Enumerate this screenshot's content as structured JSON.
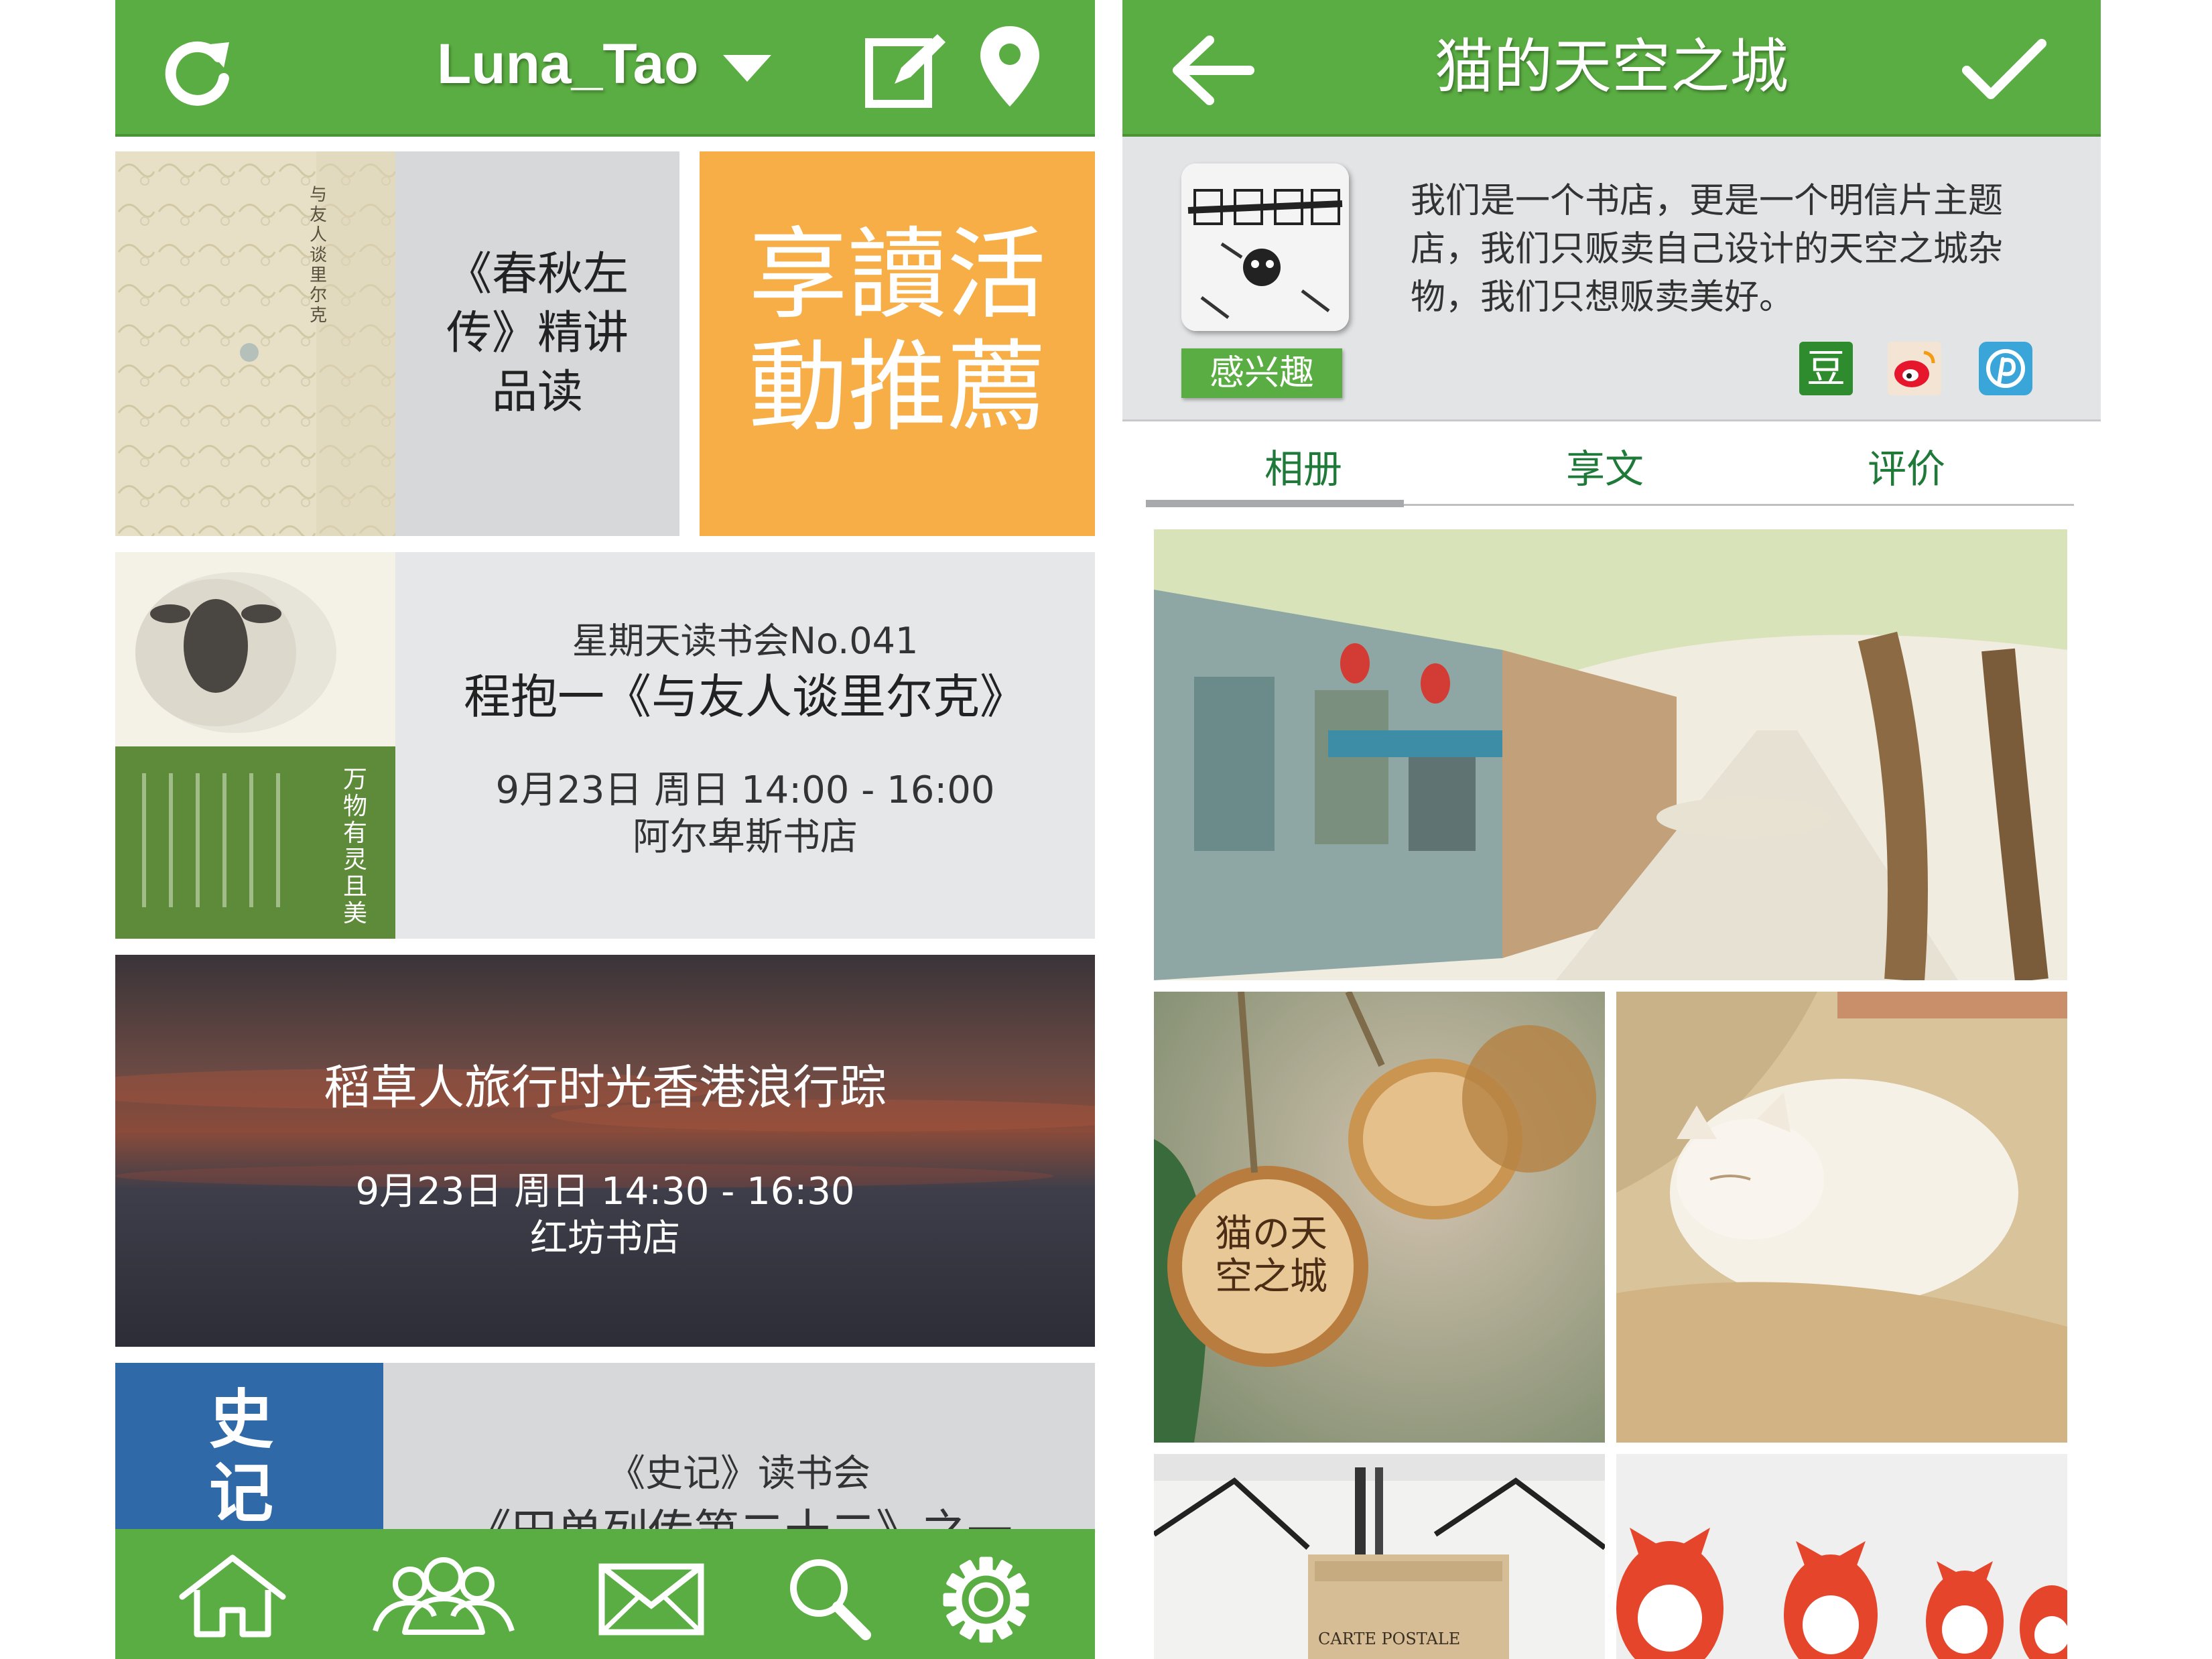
{
  "left": {
    "header": {
      "username": "Luna_Tao"
    },
    "tiles": {
      "chunqiu": {
        "label": "《春秋左传》精讲品读",
        "lines": [
          "《春秋左",
          "传》精讲",
          "品读"
        ]
      },
      "promo": {
        "lines": [
          "享讀活",
          "動推薦"
        ]
      },
      "event1": {
        "series": "星期天读书会No.041",
        "title": "程抱一《与友人谈里尔克》",
        "datetime": "9月23日 周日 14:00 - 16:00",
        "venue": "阿尔卑斯书店"
      },
      "event2": {
        "title": "稻草人旅行时光香港浪行踪",
        "datetime": "9月23日 周日 14:30 - 16:30",
        "venue": "红坊书店"
      },
      "event3": {
        "series": "《史记》读书会",
        "title_partial": "《田单列传第二十二》之一"
      }
    },
    "book_covers": {
      "rilke_vertical": "与友人谈里尔克",
      "sheep_vertical": "万物有灵且美",
      "shiji": "史记"
    }
  },
  "right": {
    "header": {
      "title": "猫的天空之城"
    },
    "shop": {
      "description_lines": [
        "我们是一个书店，更是一个明信片主题",
        "店，我们只贩卖自己设计的天空之城杂",
        "物，我们只想贩卖美好。"
      ],
      "interest_button": "感兴趣",
      "share_icons": [
        "douban-icon",
        "weibo-icon",
        "pinterest-icon"
      ],
      "douban_glyph": "豆"
    },
    "tabs": [
      {
        "label": "相册",
        "active": true
      },
      {
        "label": "享文",
        "active": false
      },
      {
        "label": "评价",
        "active": false
      }
    ],
    "photos": {
      "tag_text": "猫の天空之城",
      "postcard_box": "CARTE POSTALE"
    }
  },
  "colors": {
    "brand_green": "#5aad42",
    "promo_orange": "#f7ae46",
    "tile_gray": "#e6e7e9",
    "tab_green": "#1f7a3a"
  }
}
